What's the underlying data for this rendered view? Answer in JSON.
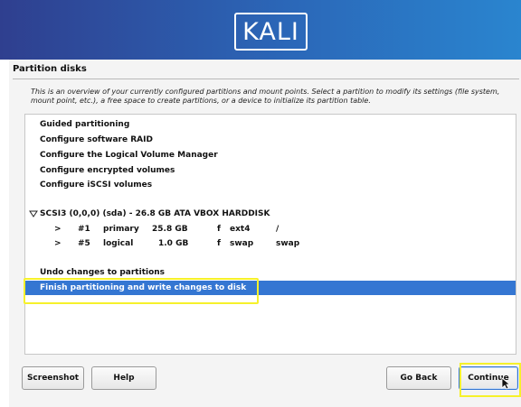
{
  "banner": {
    "logo_text": "KALI"
  },
  "section_title": "Partition disks",
  "description": "This is an overview of your currently configured partitions and mount points. Select a partition to modify its settings (file system, mount point, etc.), a free space to create partitions, or a device to initialize its partition table.",
  "menu": {
    "guided": "Guided partitioning",
    "raid": "Configure software RAID",
    "lvm": "Configure the Logical Volume Manager",
    "encrypted": "Configure encrypted volumes",
    "iscsi": "Configure iSCSI volumes"
  },
  "disk": {
    "expand_icon": "triangle-down-icon",
    "label": "SCSI3 (0,0,0) (sda) - 26.8 GB ATA VBOX HARDDISK",
    "partitions": [
      {
        "arrow": ">",
        "num": "#1",
        "type": "primary",
        "size": "25.8 GB",
        "flag": "f",
        "fs": "ext4",
        "mount": "/"
      },
      {
        "arrow": ">",
        "num": "#5",
        "type": "logical",
        "size": "1.0 GB",
        "flag": "f",
        "fs": "swap",
        "mount": "swap"
      }
    ]
  },
  "actions": {
    "undo": "Undo changes to partitions",
    "finish": "Finish partitioning and write changes to disk"
  },
  "buttons": {
    "screenshot": "Screenshot",
    "help": "Help",
    "go_back": "Go Back",
    "continue": "Continue"
  },
  "colors": {
    "selection": "#3476d2",
    "highlight": "#f6f12b",
    "banner_start": "#2f3f8f",
    "banner_end": "#2a85cf"
  },
  "icons": {
    "cursor": "mouse-pointer-icon"
  }
}
